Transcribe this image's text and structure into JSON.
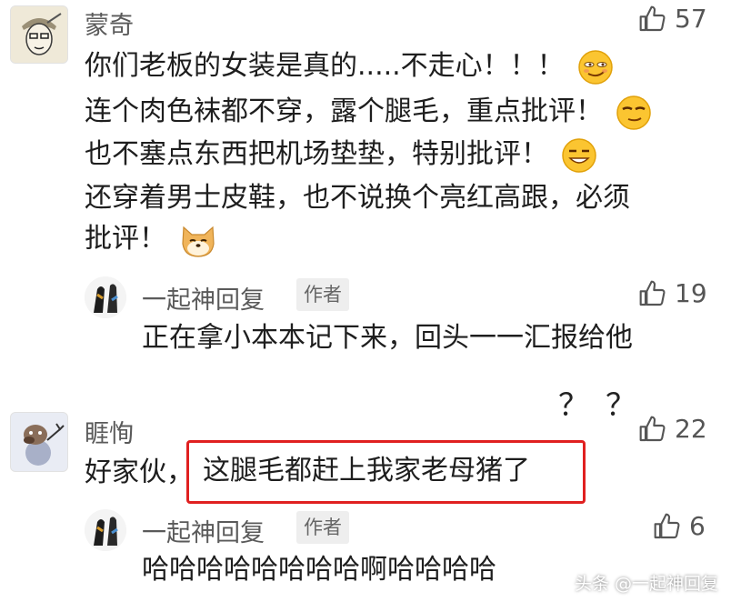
{
  "comment1": {
    "username": "蒙奇",
    "likes": "57",
    "lines": [
      "你们老板的女装是真的.....不走心！！！",
      "连个肉色袜都不穿，露个腿毛，重点批评！",
      "也不塞点东西把机场垫垫，特别批评！",
      "还穿着男士皮鞋，也不说换个亮红高跟，必须",
      "批评！"
    ],
    "reply": {
      "username": "一起神回复",
      "badge": "作者",
      "likes": "19",
      "text": "正在拿小本本记下来，回头一一汇报给他"
    }
  },
  "annotation": "？？",
  "comment2": {
    "username": "睚恂",
    "likes": "22",
    "prefix": "好家伙，",
    "highlight": "这腿毛都赶上我家老母猪了",
    "reply": {
      "username": "一起神回复",
      "badge": "作者",
      "likes": "6",
      "text": "哈哈哈哈哈哈哈哈啊哈哈哈哈"
    }
  },
  "watermark": "头条 @一起神回复",
  "colors": {
    "highlight_border": "#e02020",
    "text": "#1e1e1e",
    "muted": "#5a5a5a"
  }
}
